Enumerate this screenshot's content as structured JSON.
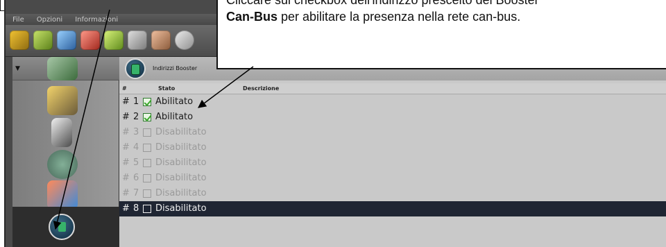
{
  "menu": {
    "file": "File",
    "opzioni": "Opzioni",
    "informazioni": "Informazioni"
  },
  "booster": {
    "label": "Indirizzi Booster"
  },
  "columns": {
    "hash": "#",
    "stato": "Stato",
    "descrizione": "Descrizione"
  },
  "rows": [
    {
      "hash": "#",
      "num": "1",
      "stato": "Abilitato",
      "checked": true
    },
    {
      "hash": "#",
      "num": "2",
      "stato": "Abilitato",
      "checked": true
    },
    {
      "hash": "#",
      "num": "3",
      "stato": "Disabilitato",
      "checked": false
    },
    {
      "hash": "#",
      "num": "4",
      "stato": "Disabilitato",
      "checked": false
    },
    {
      "hash": "#",
      "num": "5",
      "stato": "Disabilitato",
      "checked": false
    },
    {
      "hash": "#",
      "num": "6",
      "stato": "Disabilitato",
      "checked": false
    },
    {
      "hash": "#",
      "num": "7",
      "stato": "Disabilitato",
      "checked": false
    },
    {
      "hash": "#",
      "num": "8",
      "stato": "Disabilitato",
      "checked": false
    }
  ],
  "callout": {
    "line1": "Cliccare sul checkbox dell'indirizzo prescelto del Booster",
    "line2_bold": "Can-Bus",
    "line2_rest": " per abilitare la presenza nella rete can-bus."
  },
  "colors": {
    "selected_row": "#1f2533",
    "check_green": "#3aa52b"
  }
}
